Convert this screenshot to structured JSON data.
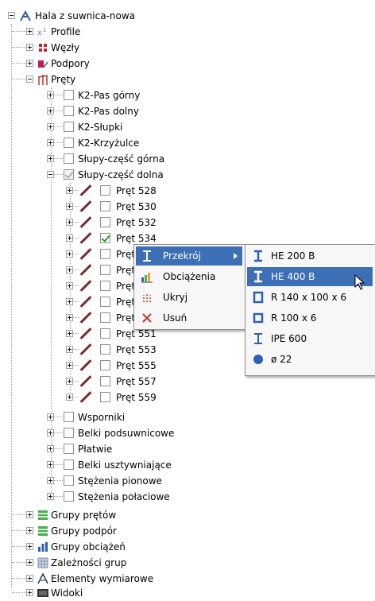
{
  "tree": {
    "root": "Hala z suwnica-nowa",
    "profile": "Profile",
    "wezly": "Węzły",
    "podpory": "Podpory",
    "prety": "Pręty",
    "groups": [
      "K2-Pas górny",
      "K2-Pas dolny",
      "K2-Słupki",
      "K2-Krzyżulce",
      "Słupy-część górna",
      "Słupy-część dolna"
    ],
    "bars": [
      "Pręt 528",
      "Pręt 530",
      "Pręt 532",
      "Pręt 534",
      "Pręt",
      "Pręt",
      "Pręt",
      "Pręt",
      "Pręt",
      "Pręt 551",
      "Pręt 553",
      "Pręt 555",
      "Pręt 557",
      "Pręt 559"
    ],
    "groups2": [
      "Wsporniki",
      "Belki podsuwnicowe",
      "Płatwie",
      "Belki usztywniające",
      "Stężenia pionowe",
      "Stężenia połaciowe"
    ],
    "top_items": [
      "Grupy prętów",
      "Grupy podpór",
      "Grupy obciążeń",
      "Zależności grup",
      "Elementy wymiarowe",
      "Widoki"
    ]
  },
  "context_menu": {
    "items": [
      "Przekrój",
      "Obciążenia",
      "Ukryj",
      "Usuń"
    ]
  },
  "submenu": {
    "items": [
      "HE 200 B",
      "HE 400 B",
      "R 140 x 100 x 6",
      "R 100 x 6",
      "IPE 600",
      "ø 22"
    ]
  },
  "colors": {
    "highlight": "#3d6fb6",
    "bar_icon": "#7a2a2a"
  }
}
